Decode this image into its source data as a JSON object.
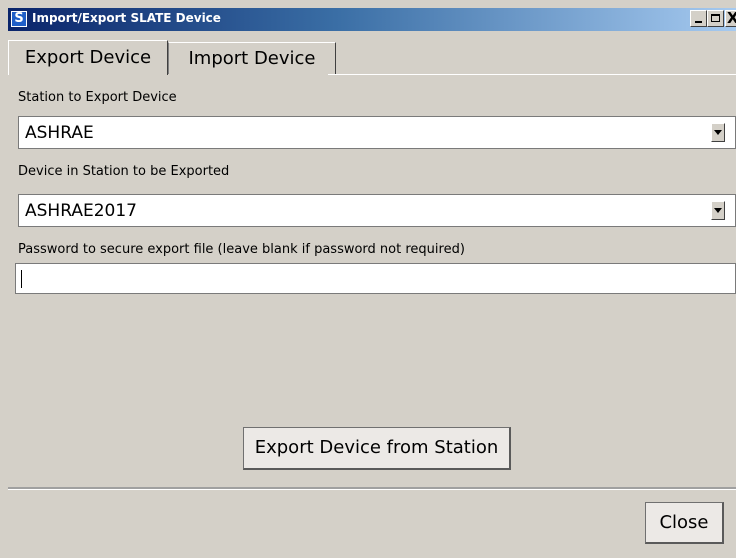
{
  "window": {
    "title": "Import/Export SLATE Device",
    "app_icon_letter": "S",
    "min_label": "",
    "close_label": "X"
  },
  "tabs": [
    {
      "label": "Export Device",
      "active": true
    },
    {
      "label": "Import Device",
      "active": false
    }
  ],
  "station": {
    "label": "Station to Export Device",
    "value": "ASHRAE"
  },
  "device": {
    "label": "Device in Station to be Exported",
    "value": "ASHRAE2017"
  },
  "password": {
    "label": "Password to secure export file (leave blank if password not required)",
    "value": ""
  },
  "actions": {
    "export_label": "Export Device from Station",
    "close_label": "Close"
  }
}
